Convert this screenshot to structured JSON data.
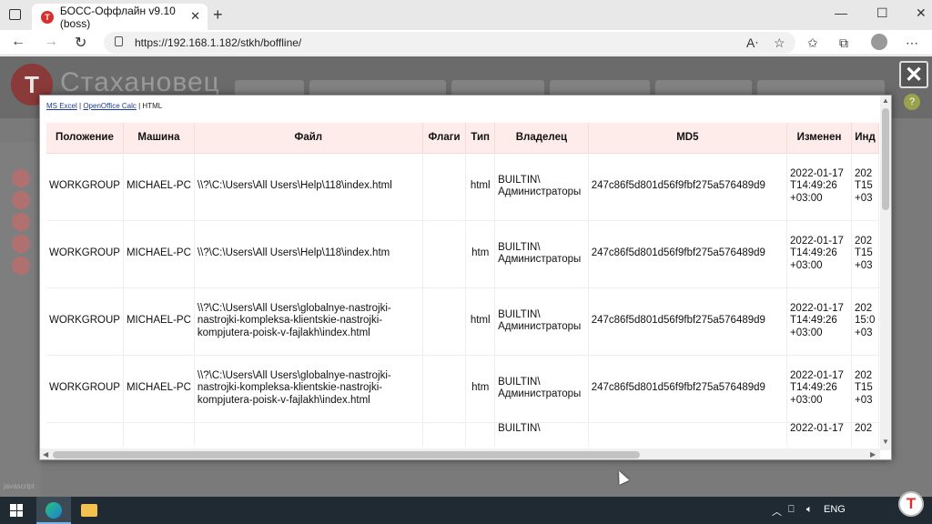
{
  "browser": {
    "tab_title": "БОСС-Оффлайн v9.10 (boss)",
    "favicon_letter": "Т",
    "url": "https://192.168.1.182/stkh/boffline/"
  },
  "app": {
    "logo_letter": "Т",
    "title": "Стахановец",
    "status_text": "javascript"
  },
  "modal": {
    "close_label": "✕",
    "export_links": {
      "excel": "MS Excel",
      "calc": "OpenOffice Calc",
      "html": "HTML"
    },
    "table": {
      "columns": [
        "Положение",
        "Машина",
        "Файл",
        "Флаги",
        "Тип",
        "Владелец",
        "MD5",
        "Изменен",
        "Инд"
      ],
      "rows": [
        [
          "WORKGROUP",
          "MICHAEL-PC",
          "\\\\?\\C:\\Users\\All Users\\Help\\118\\index.html",
          "",
          "html",
          "BUILTIN\\ Администраторы",
          "247c86f5d801d56f9fbf275a576489d9",
          "2022-01-17 T14:49:26 +03:00",
          "202 T15 +03"
        ],
        [
          "WORKGROUP",
          "MICHAEL-PC",
          "\\\\?\\C:\\Users\\All Users\\Help\\118\\index.htm",
          "",
          "htm",
          "BUILTIN\\ Администраторы",
          "247c86f5d801d56f9fbf275a576489d9",
          "2022-01-17 T14:49:26 +03:00",
          "202 T15 +03"
        ],
        [
          "WORKGROUP",
          "MICHAEL-PC",
          "\\\\?\\C:\\Users\\All Users\\globalnye-nastrojki-nastrojki-kompleksa-klientskie-nastrojki-kompjutera-poisk-v-fajlakh\\index.html",
          "",
          "html",
          "BUILTIN\\ Администраторы",
          "247c86f5d801d56f9fbf275a576489d9",
          "2022-01-17 T14:49:26 +03:00",
          "202 15:0 +03"
        ],
        [
          "WORKGROUP",
          "MICHAEL-PC",
          "\\\\?\\C:\\Users\\All Users\\globalnye-nastrojki-nastrojki-kompleksa-klientskie-nastrojki-kompjutera-poisk-v-fajlakh\\index.html",
          "",
          "htm",
          "BUILTIN\\ Администраторы",
          "247c86f5d801d56f9fbf275a576489d9",
          "2022-01-17 T14:49:26 +03:00",
          "202 T15 +03"
        ],
        [
          "",
          "",
          "",
          "",
          "",
          "BUILTIN\\",
          "",
          "2022-01-17",
          "202"
        ]
      ]
    }
  },
  "taskbar": {
    "language": "ENG",
    "tray_letter": "Т"
  }
}
